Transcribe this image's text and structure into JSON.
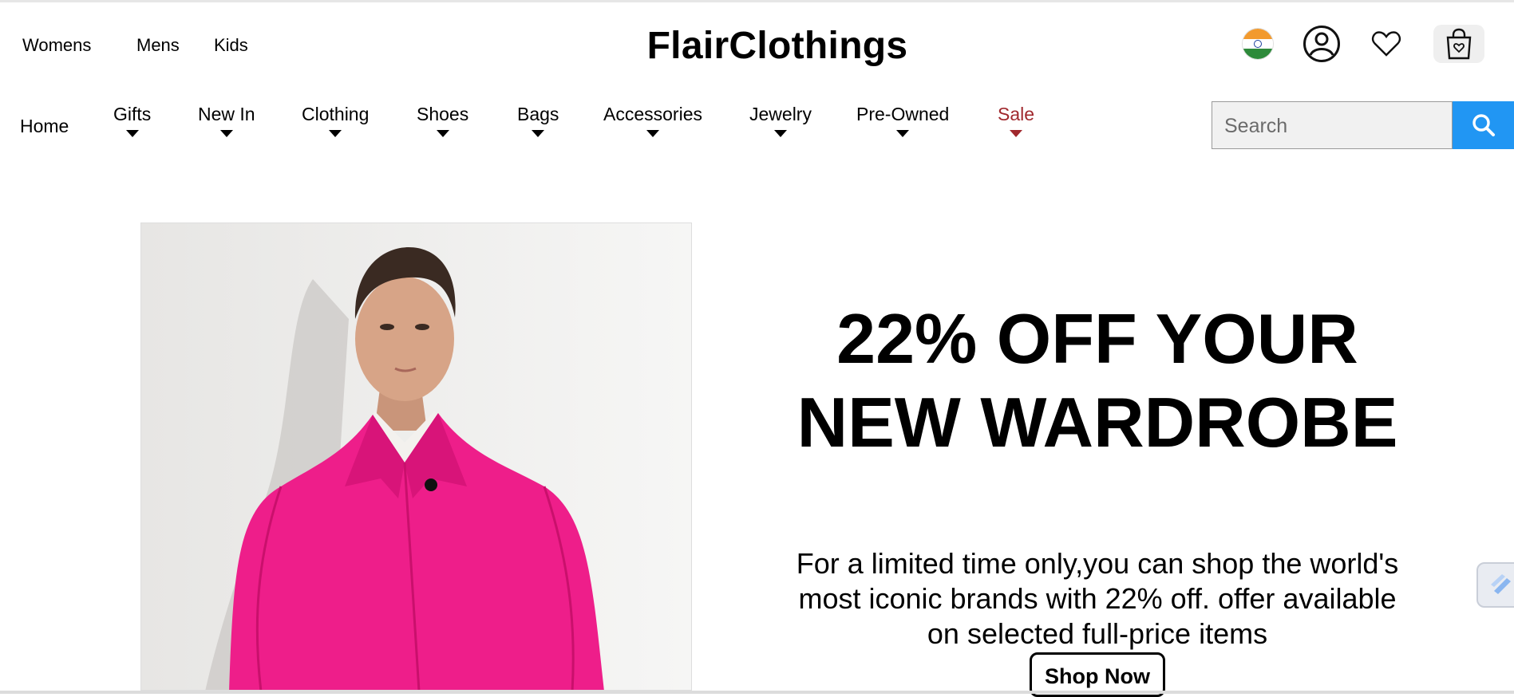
{
  "gender_nav": [
    "Womens",
    "Mens",
    "Kids"
  ],
  "brand": {
    "name": "FlairClothings"
  },
  "utility": {
    "flag": "india-flag-icon",
    "account": "user-account-icon",
    "wishlist": "heart-icon",
    "bag": "shopping-bag-icon"
  },
  "category_nav": {
    "home": "Home",
    "items": [
      "Gifts",
      "New In",
      "Clothing",
      "Shoes",
      "Bags",
      "Accessories",
      "Jewelry",
      "Pre-Owned",
      "Sale"
    ],
    "sale_color": "#a0282d"
  },
  "search": {
    "placeholder": "Search",
    "button_color": "#2196f3"
  },
  "hero": {
    "headline": "22% OFF YOUR NEW WARDROBE",
    "subtext": "For a limited time only,you can shop the world's most iconic brands with 22% off. offer available on selected full-price items",
    "cta": "Shop Now",
    "image_accent": "#ee1e8a"
  }
}
